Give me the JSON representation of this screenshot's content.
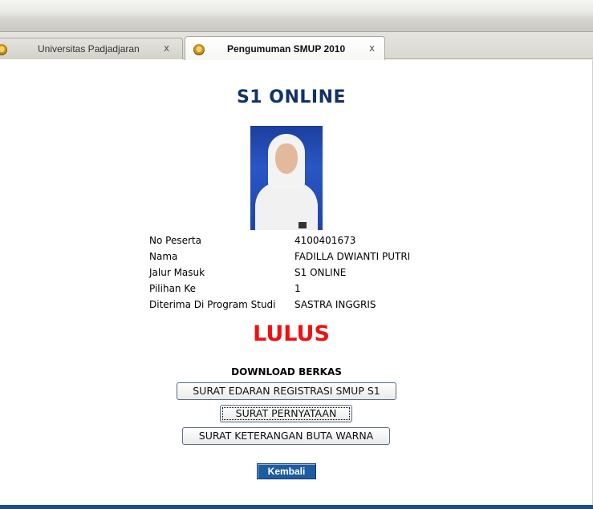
{
  "tabs": [
    {
      "label": "Universitas Padjadjaran",
      "close": "x",
      "active": false
    },
    {
      "label": "Pengumuman SMUP 2010",
      "close": "x",
      "active": true
    }
  ],
  "page": {
    "heading": "S1 ONLINE",
    "info": [
      {
        "label": "No Peserta",
        "value": "4100401673"
      },
      {
        "label": "Nama",
        "value": "FADILLA DWIANTI PUTRI"
      },
      {
        "label": "Jalur Masuk",
        "value": "S1 ONLINE"
      },
      {
        "label": "Pilihan Ke",
        "value": "1"
      },
      {
        "label": "Diterima Di Program Studi",
        "value": "SASTRA INGGRIS"
      }
    ],
    "status": "LULUS",
    "download_title": "DOWNLOAD BERKAS",
    "buttons": [
      "SURAT EDARAN REGISTRASI SMUP S1",
      "SURAT PERNYATAAN",
      "SURAT KETERANGAN BUTA WARNA"
    ],
    "back_button": "Kembali"
  },
  "colors": {
    "heading": "#113366",
    "status": "#ee1111",
    "back_button": "#1e5ca0",
    "photo_background": "#2a56c4"
  }
}
